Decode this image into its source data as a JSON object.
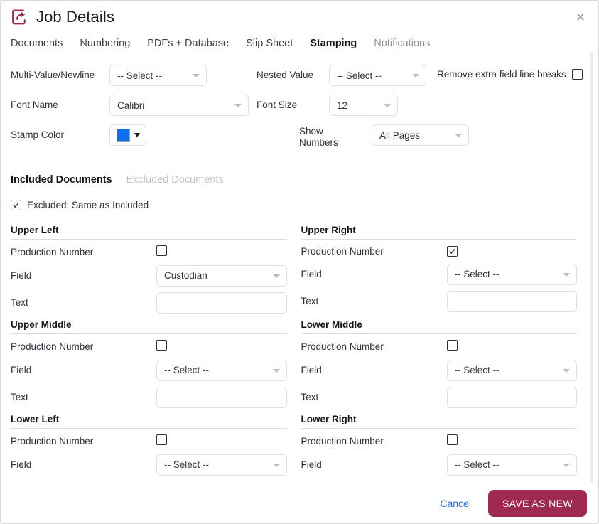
{
  "window": {
    "title": "Job Details",
    "icon": "export-share-icon",
    "close_label": "×"
  },
  "tabs": [
    {
      "label": "Documents",
      "active": false
    },
    {
      "label": "Numbering",
      "active": false
    },
    {
      "label": "PDFs + Database",
      "active": false
    },
    {
      "label": "Slip Sheet",
      "active": false
    },
    {
      "label": "Stamping",
      "active": true
    },
    {
      "label": "Notifications",
      "active": false,
      "muted": true
    }
  ],
  "settings": {
    "multi_value": {
      "label": "Multi-Value/Newline",
      "value": "-- Select --"
    },
    "nested_value": {
      "label": "Nested Value",
      "value": "-- Select --"
    },
    "remove_breaks": {
      "label": "Remove extra field line breaks",
      "checked": false
    },
    "font_name": {
      "label": "Font Name",
      "value": "Calibri"
    },
    "font_size": {
      "label": "Font Size",
      "value": "12"
    },
    "stamp_color": {
      "label": "Stamp Color",
      "value": "#0a6ff0"
    },
    "show_numbers": {
      "label": "Show Numbers",
      "value": "All Pages"
    }
  },
  "doc_tabs": [
    {
      "label": "Included Documents",
      "active": true
    },
    {
      "label": "Excluded Documents",
      "active": false,
      "disabled": true
    }
  ],
  "same_as_included": {
    "label": "Excluded: Same as Included",
    "checked": true
  },
  "corner_labels": {
    "production_number": "Production Number",
    "field": "Field",
    "text": "Text"
  },
  "corners": [
    {
      "title": "Upper Left",
      "production_number_checked": false,
      "field_value": "Custodian",
      "text_value": "",
      "has_text": true
    },
    {
      "title": "Upper Right",
      "production_number_checked": true,
      "field_value": "-- Select --",
      "text_value": "",
      "has_text": true
    },
    {
      "title": "Upper Middle",
      "production_number_checked": false,
      "field_value": "-- Select --",
      "text_value": "",
      "has_text": true
    },
    {
      "title": "Lower Middle",
      "production_number_checked": false,
      "field_value": "-- Select --",
      "text_value": "",
      "has_text": true
    },
    {
      "title": "Lower Left",
      "production_number_checked": false,
      "field_value": "-- Select --",
      "text_value": "",
      "has_text": false
    },
    {
      "title": "Lower Right",
      "production_number_checked": false,
      "field_value": "-- Select --",
      "text_value": "",
      "has_text": false
    }
  ],
  "footer": {
    "cancel_label": "Cancel",
    "save_label": "SAVE AS NEW",
    "save_color": "#9e2a4f"
  }
}
